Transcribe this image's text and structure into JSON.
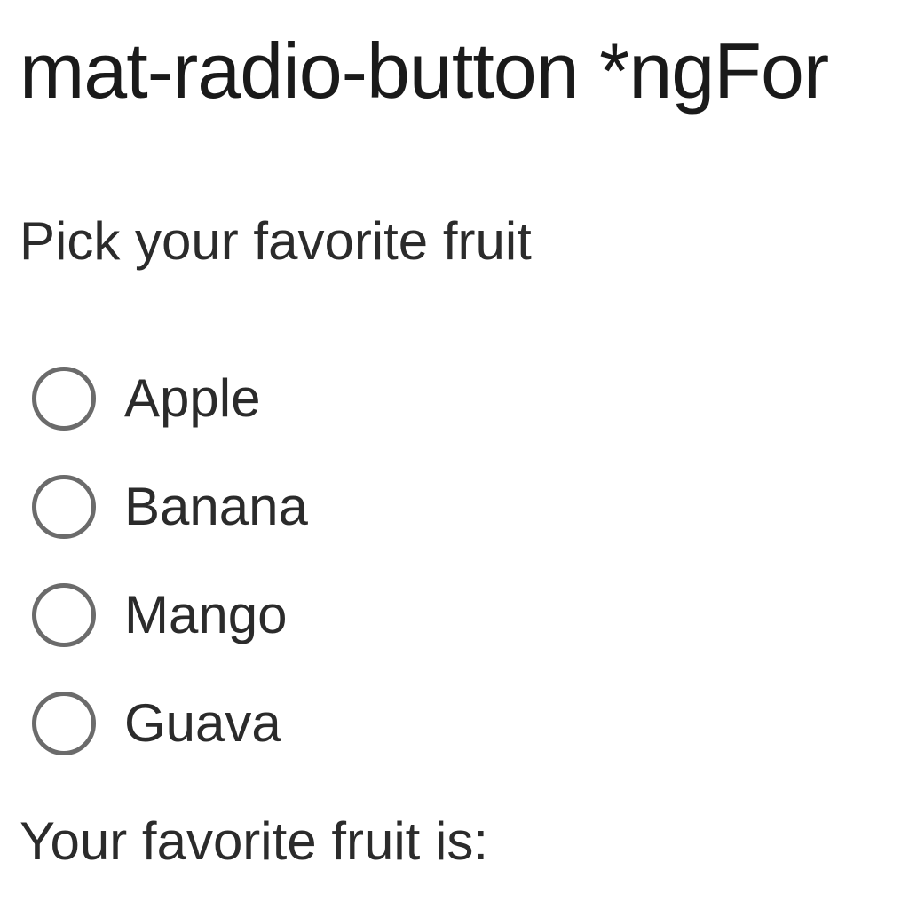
{
  "title": "mat-radio-button *ngFor",
  "radio_group": {
    "label": "Pick your favorite fruit",
    "options": [
      {
        "label": "Apple",
        "selected": false
      },
      {
        "label": "Banana",
        "selected": false
      },
      {
        "label": "Mango",
        "selected": false
      },
      {
        "label": "Guava",
        "selected": false
      }
    ]
  },
  "result": {
    "label": "Your favorite fruit is:",
    "value": ""
  }
}
